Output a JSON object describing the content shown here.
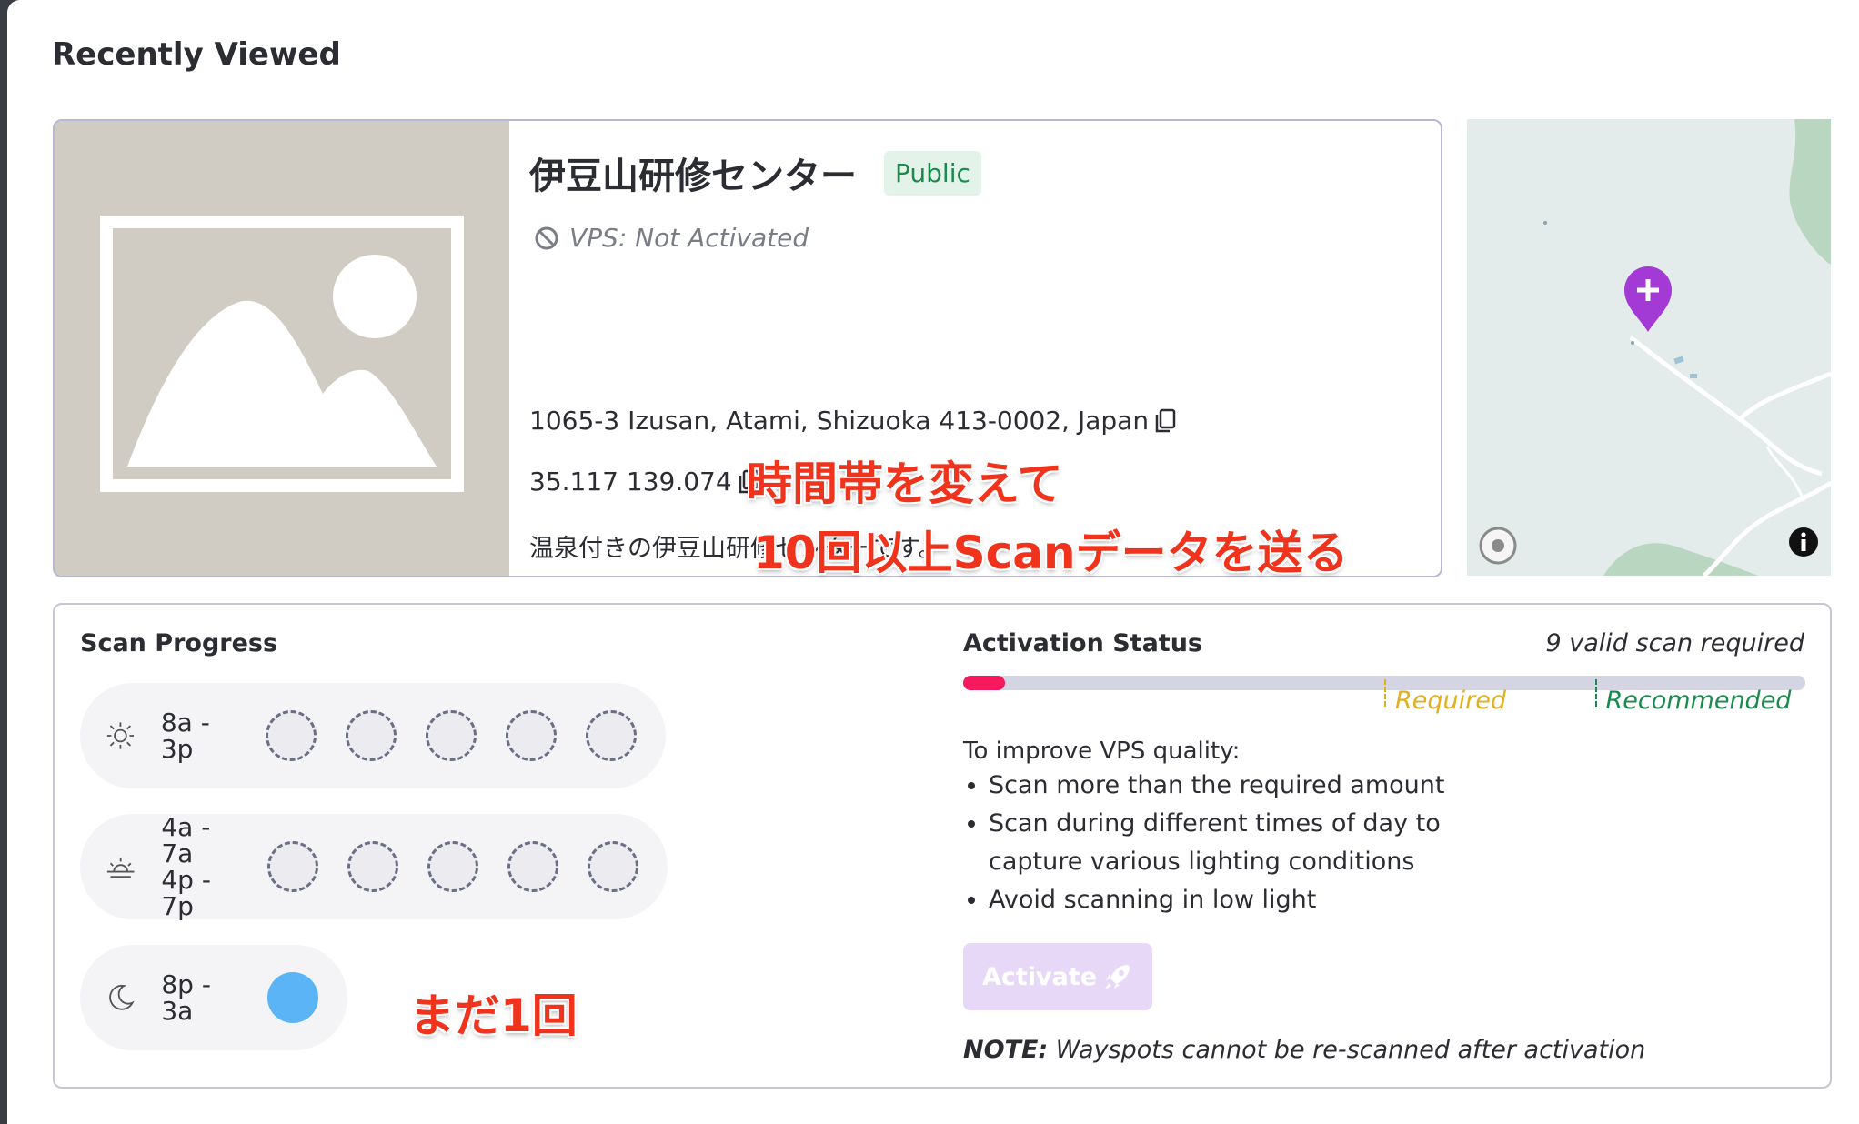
{
  "section_title": "Recently Viewed",
  "wayspot": {
    "name": "伊豆山研修センター",
    "visibility_badge": "Public",
    "vps_status": "VPS: Not Activated",
    "address": "1065-3 Izusan, Atami, Shizuoka 413-0002, Japan",
    "coordinates": "35.117 139.074",
    "description": "温泉付きの伊豆山研修センターです。"
  },
  "annotations": {
    "line1": "時間帯を変えて",
    "line2": "10回以上Scanデータを送る",
    "scan_count_note": "まだ1回"
  },
  "scan_progress": {
    "title": "Scan Progress",
    "slots": [
      {
        "label_lines": [
          "8a - 3p"
        ],
        "icon": "sun-icon",
        "completed": 0,
        "total": 5
      },
      {
        "label_lines": [
          "4a - 7a",
          "4p - 7p"
        ],
        "icon": "sunrise-icon",
        "completed": 0,
        "total": 5
      },
      {
        "label_lines": [
          "8p - 3a"
        ],
        "icon": "moon-icon",
        "completed": 1,
        "total": 1
      }
    ]
  },
  "activation": {
    "title": "Activation Status",
    "requirement": "9 valid scan required",
    "progress_fraction": 0.05,
    "required_marker_fraction": 0.5,
    "recommended_marker_fraction": 0.75,
    "required_label": "Required",
    "recommended_label": "Recommended",
    "tips_title": "To improve VPS quality:",
    "tips": [
      "Scan more than the required amount",
      "Scan during different times of day to capture various lighting conditions",
      "Avoid scanning in low light"
    ],
    "activate_label": "Activate",
    "note_label": "NOTE:",
    "note_text": " Wayspots cannot be re-scanned after activation"
  },
  "colors": {
    "progress_fill": "#f7195d",
    "required": "#e0b020",
    "recommended": "#1c8a4e",
    "pin": "#a33ad6",
    "scan_done": "#5ab4f6"
  }
}
